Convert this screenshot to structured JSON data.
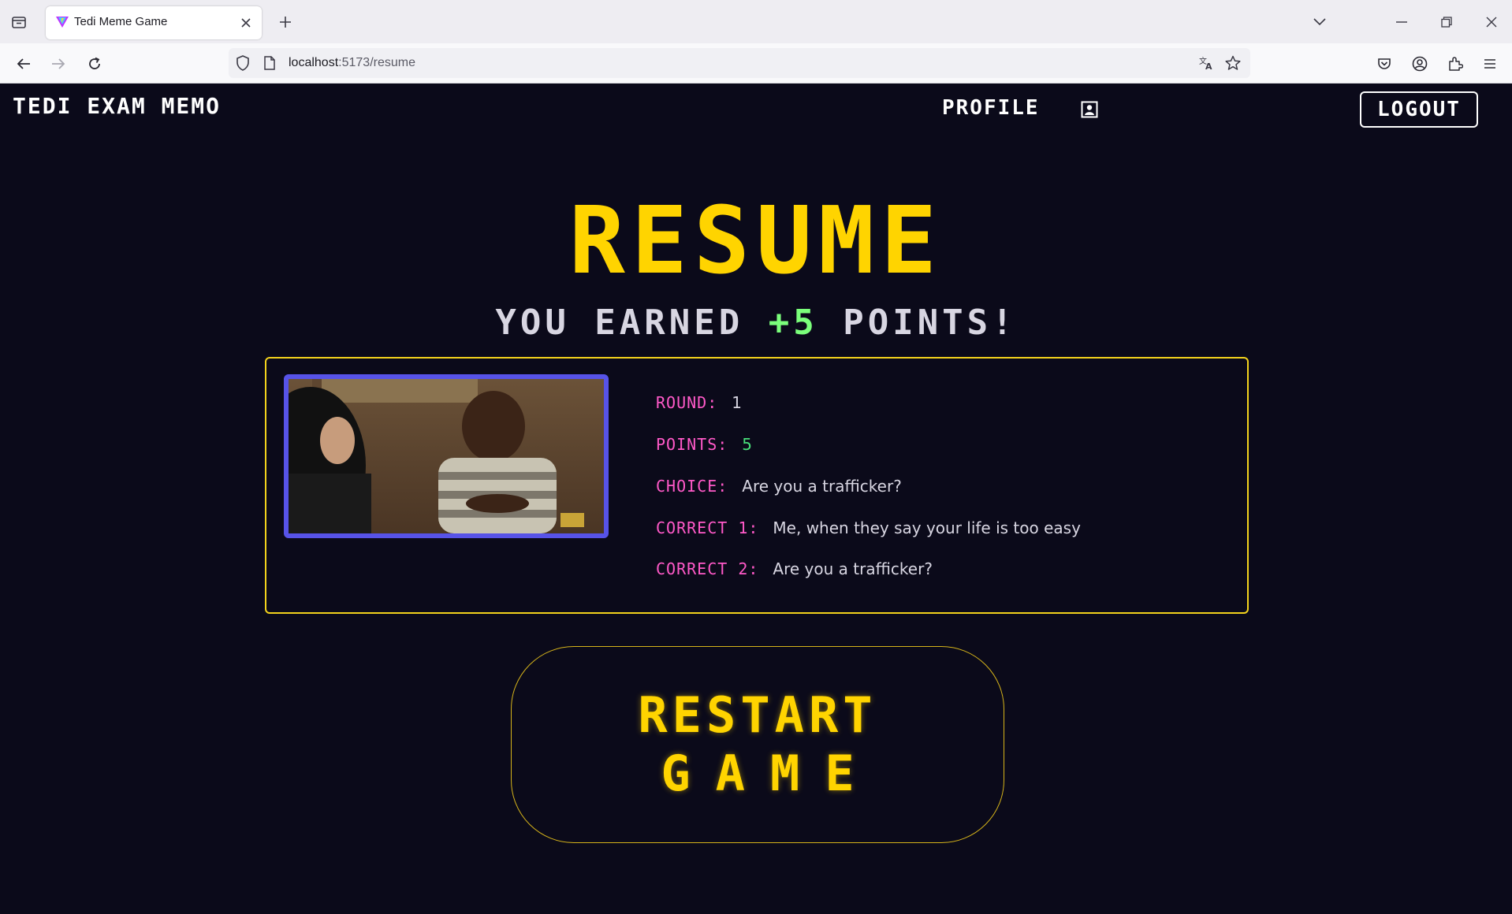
{
  "browser": {
    "tab_title": "Tedi Meme Game",
    "url_host": "localhost",
    "url_path": ":5173/resume"
  },
  "header": {
    "brand": "TEDI EXAM MEMO",
    "profile": "PROFILE",
    "logout": "LOGOUT"
  },
  "main": {
    "title": "RESUME",
    "earned_prefix": "YOU EARNED ",
    "earned_points": "+5",
    "earned_suffix": " POINTS!",
    "round": {
      "meme_alt": "meme image",
      "rows": [
        {
          "label": "ROUND:",
          "value": "1"
        },
        {
          "label": "POINTS:",
          "value": "5"
        },
        {
          "label": "CHOICE:",
          "value": "Are you a trafficker?"
        },
        {
          "label": "CORRECT 1:",
          "value": "Me, when they say your life is too easy"
        },
        {
          "label": "CORRECT 2:",
          "value": "Are you a trafficker?"
        }
      ]
    },
    "restart_line1": "RESTART",
    "restart_line2": "GAME"
  },
  "colors": {
    "background": "#0b0a1a",
    "accent_yellow": "#ffd400",
    "label_pink": "#ff59c8",
    "points_green": "#48e07a",
    "frame_blue": "#5753e8"
  }
}
